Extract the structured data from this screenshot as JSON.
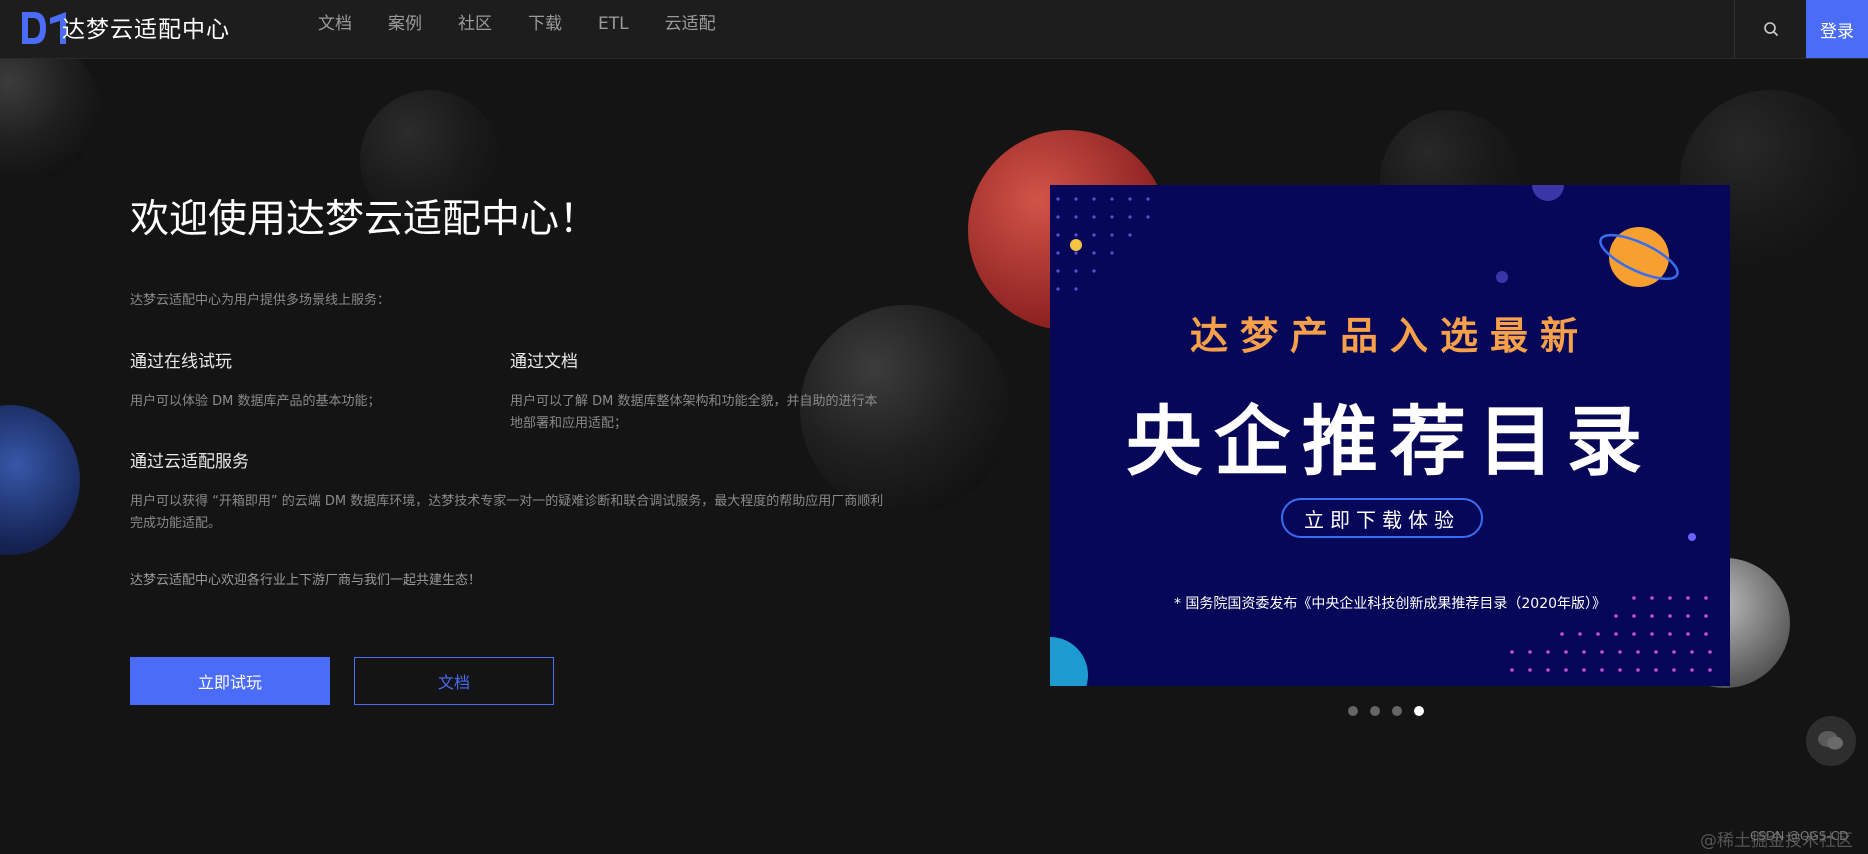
{
  "brand": {
    "name": "达梦云适配中心"
  },
  "nav": {
    "items": [
      "文档",
      "案例",
      "社区",
      "下载",
      "ETL",
      "云适配"
    ],
    "search_icon": "search-icon",
    "login_label": "登录"
  },
  "hero": {
    "title": "欢迎使用达梦云适配中心！",
    "intro": "达梦云适配中心为用户提供多场景线上服务：",
    "features": [
      {
        "title": "通过在线试玩",
        "desc": "用户可以体验 DM 数据库产品的基本功能；"
      },
      {
        "title": "通过文档",
        "desc": "用户可以了解 DM 数据库整体架构和功能全貌，并自助的进行本地部署和应用适配；"
      },
      {
        "title": "通过云适配服务",
        "desc": "用户可以获得 “开箱即用” 的云端 DM 数据库环境，达梦技术专家一对一的疑难诊断和联合调试服务，最大程度的帮助应用厂商顺利完成功能适配。"
      }
    ],
    "closing": "达梦云适配中心欢迎各行业上下游厂商与我们一起共建生态！",
    "primary_button": "立即试玩",
    "secondary_button": "文档"
  },
  "banner": {
    "line1": "达梦产品入选最新",
    "line2": "央企推荐目录",
    "cta": "立即下载体验",
    "footnote": "* 国务院国资委发布《中央企业科技创新成果推荐目录（2020年版）》",
    "slides_total": 4,
    "active_slide": 4
  },
  "watermarks": {
    "left": "@稀土掘金技术社区",
    "right": "CSDN @QGS-CD"
  },
  "colors": {
    "accent": "#4a6cf7",
    "banner_bg": "#07075a",
    "banner_highlight": "#f7a04a"
  }
}
